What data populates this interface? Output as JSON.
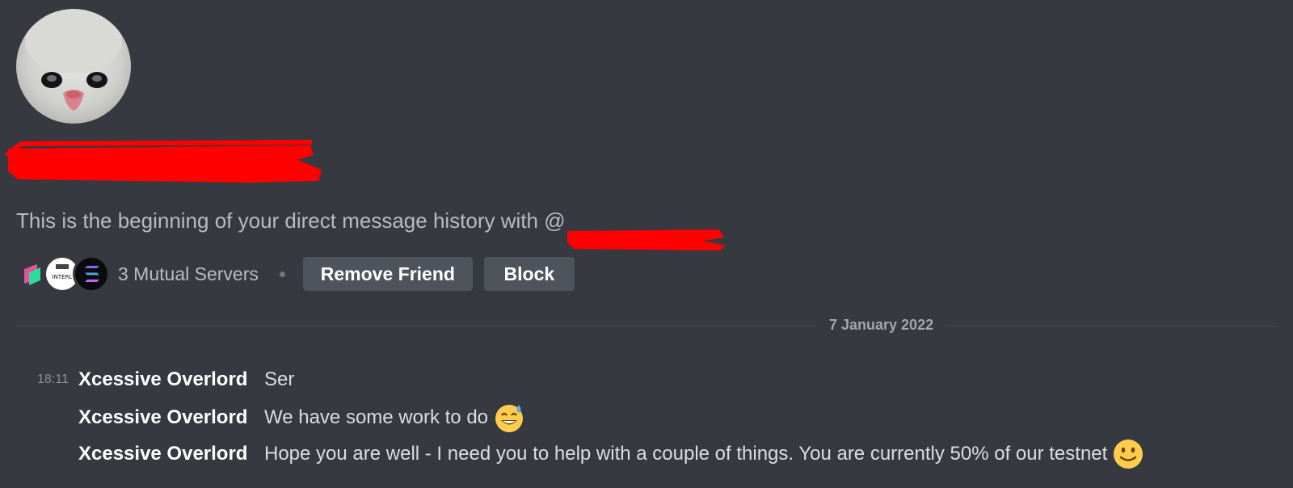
{
  "dm_header": {
    "intro_text": "This is the beginning of your direct message history with @",
    "mutual_servers_label": "3 Mutual Servers",
    "remove_friend_label": "Remove Friend",
    "block_label": "Block"
  },
  "mutual_servers": [
    {
      "icon": "green-pink-logo-icon"
    },
    {
      "icon": "interlay-logo-icon",
      "text": "INTERL"
    },
    {
      "icon": "solana-logo-icon"
    }
  ],
  "date_divider": "7 January 2022",
  "messages": [
    {
      "timestamp": "18:11",
      "author": "Xcessive Overlord",
      "text": "Ser",
      "emoji": ""
    },
    {
      "timestamp": "",
      "author": "Xcessive Overlord",
      "text": "We have some work to do",
      "emoji": "sweat-smile-emoji"
    },
    {
      "timestamp": "",
      "author": "Xcessive Overlord",
      "text": "Hope you are well - I need you to help with a couple of things. You are currently 50% of our testnet",
      "emoji": "slight-smile-emoji"
    }
  ],
  "colors": {
    "background": "#36393f",
    "button": "#4f545c",
    "redaction": "#ff0000"
  }
}
